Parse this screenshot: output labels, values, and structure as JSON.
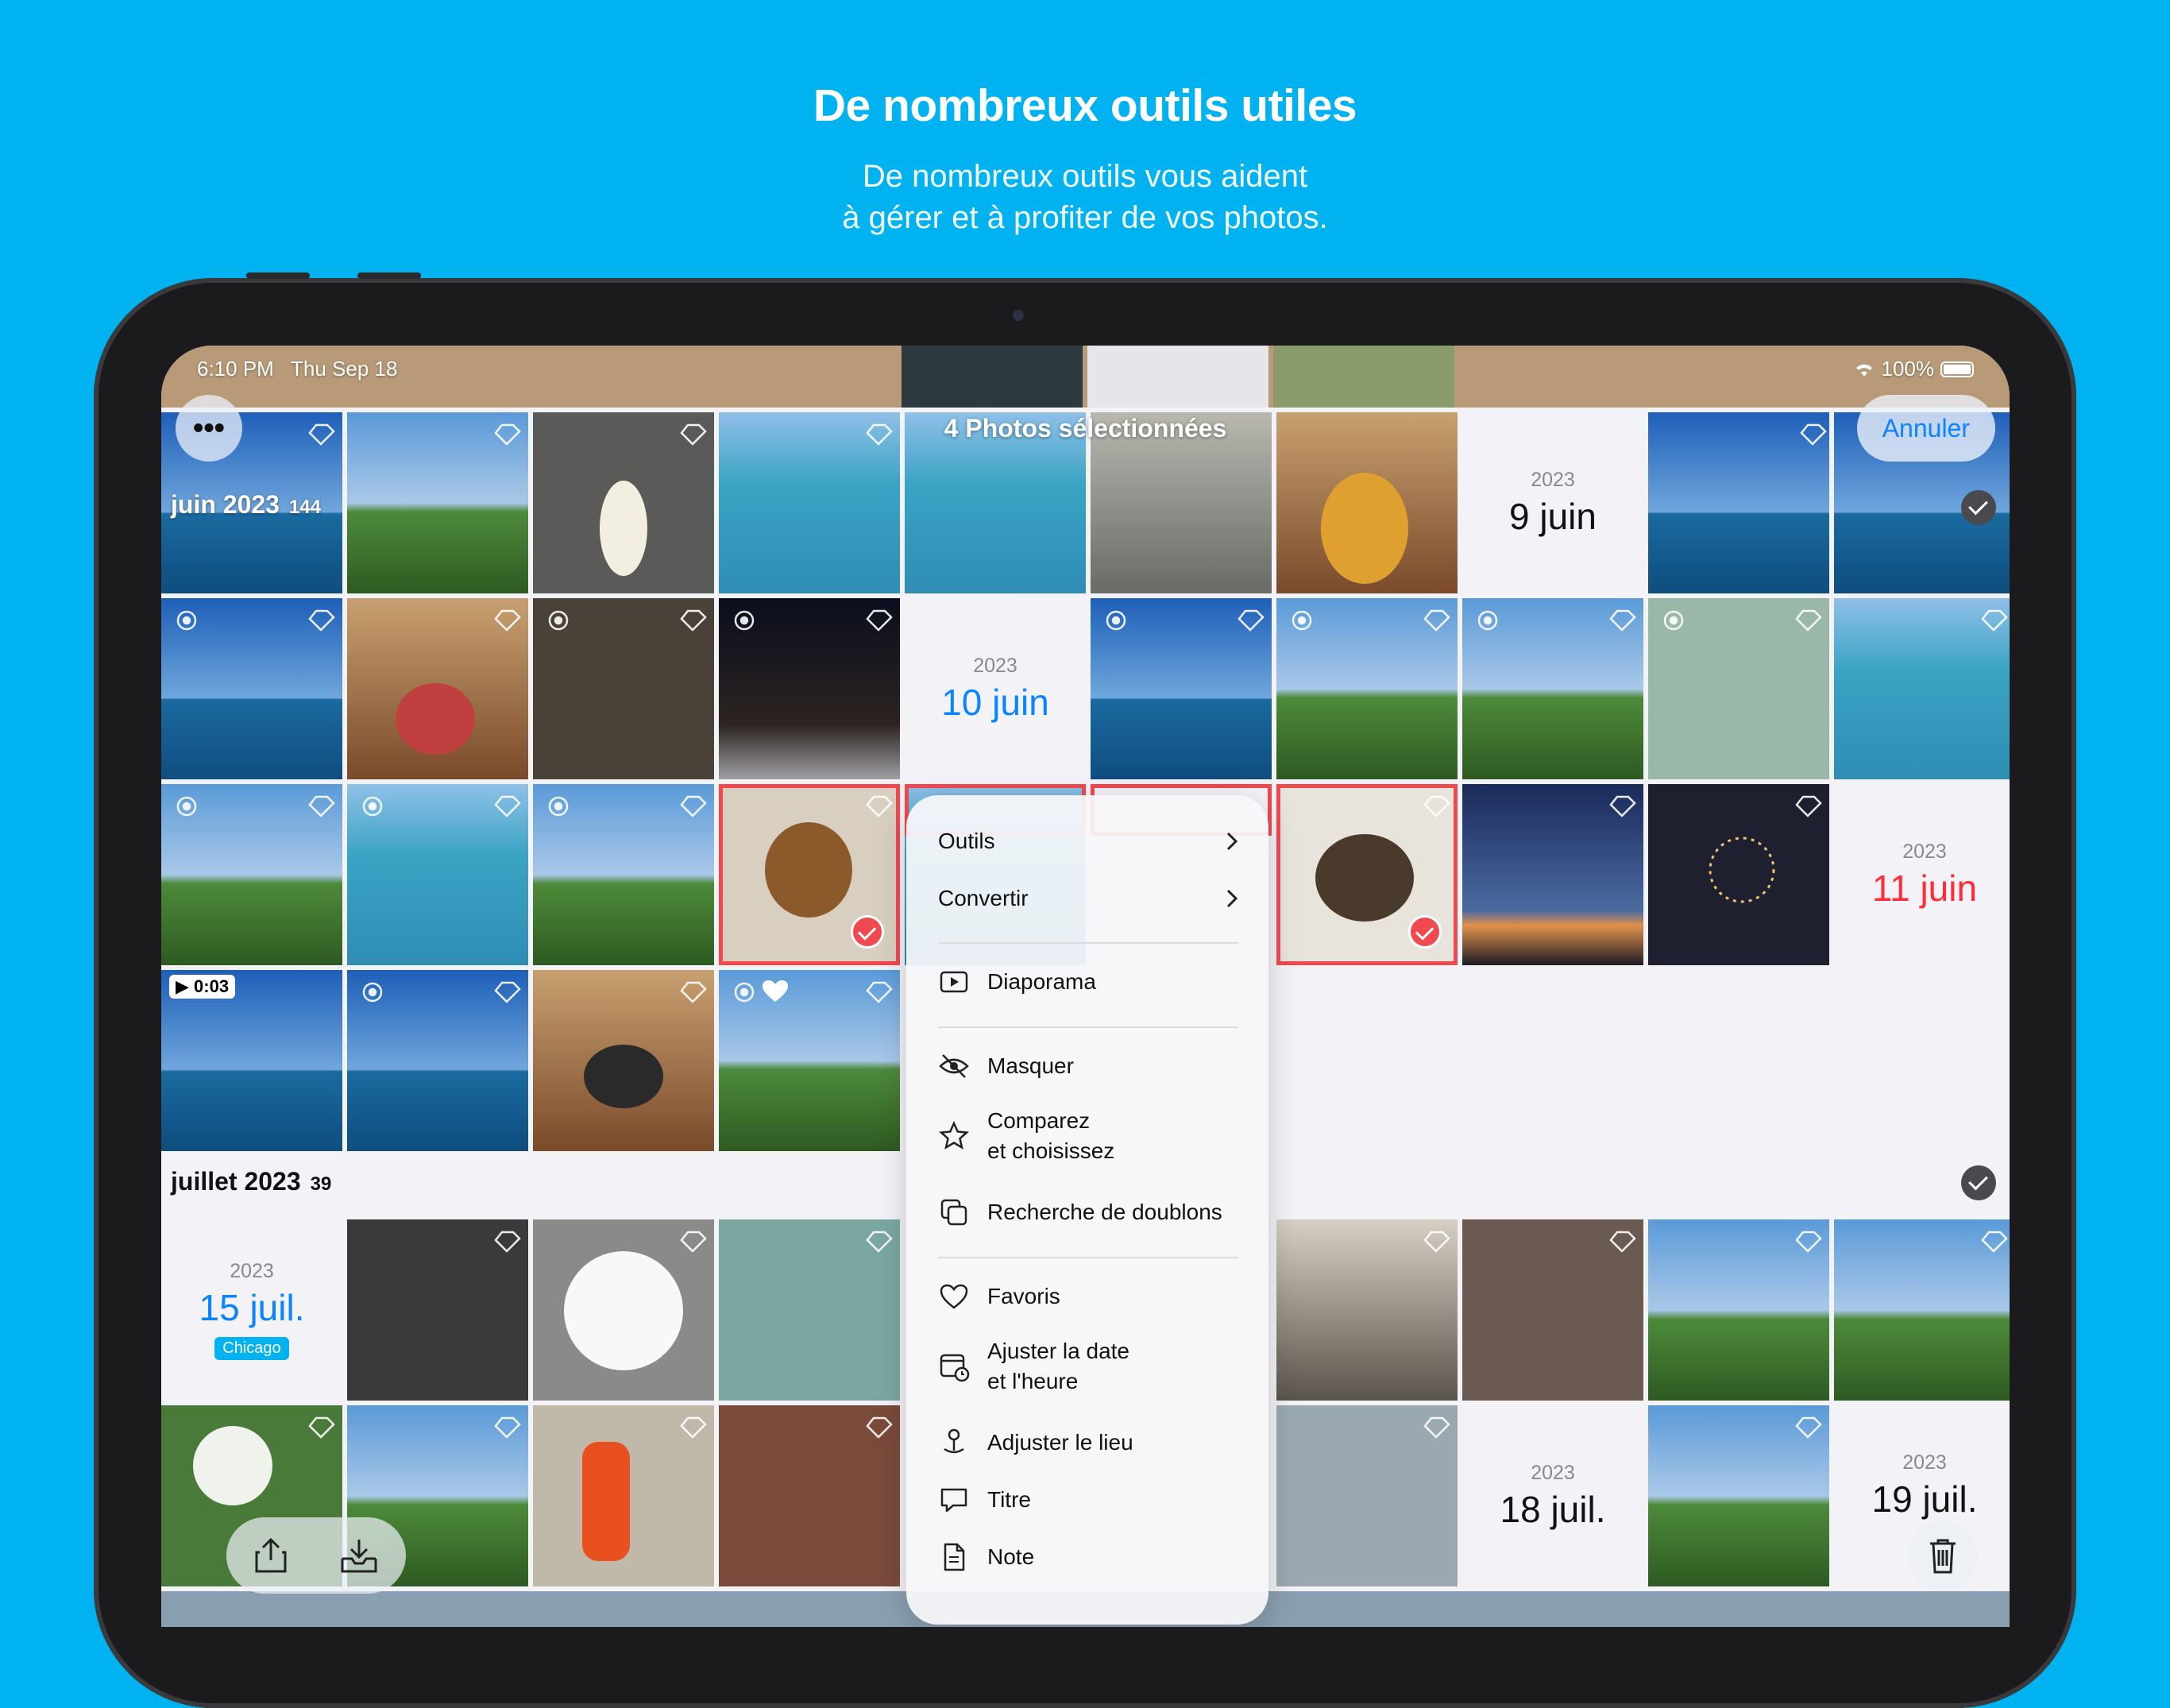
{
  "marketing": {
    "title": "De nombreux outils utiles",
    "subtitle_line1": "De nombreux outils vous aident",
    "subtitle_line2": "à gérer et à profiter de vos photos."
  },
  "status_bar": {
    "time": "6:10 PM",
    "date": "Thu Sep 18",
    "battery": "100%"
  },
  "nav": {
    "title": "4 Photos sélectionnées",
    "more_label": "•••",
    "cancel_label": "Annuler"
  },
  "sections": {
    "june": {
      "label": "juin 2023",
      "count": "144"
    },
    "july": {
      "label": "juillet 2023",
      "count": "39"
    }
  },
  "date_tiles": {
    "d9juin": {
      "year": "2023",
      "day": "9 juin"
    },
    "d10juin": {
      "year": "2023",
      "day": "10 juin"
    },
    "d11juin": {
      "year": "2023",
      "day": "11 juin"
    },
    "d15juil": {
      "year": "2023",
      "day": "15 juil.",
      "place": "Chicago"
    },
    "d18juil": {
      "year": "2023",
      "day": "18 juil."
    },
    "d19juil": {
      "year": "2023",
      "day": "19 juil."
    }
  },
  "video_duration": "▶ 0:03",
  "menu": {
    "outils": "Outils",
    "convertir": "Convertir",
    "diaporama": "Diaporama",
    "masquer": "Masquer",
    "comparez_1": "Comparez",
    "comparez_2": "et choisissez",
    "doublons": "Recherche de doublons",
    "favoris": "Favoris",
    "ajuster_date_1": "Ajuster la date",
    "ajuster_date_2": "et l'heure",
    "ajuster_lieu": "Adjuster le lieu",
    "titre": "Titre",
    "note": "Note"
  },
  "colors": {
    "brand_bg": "#00b2f0",
    "accent": "#0a84ff",
    "selection": "#f0494f",
    "date_red": "#ff2d3a"
  }
}
